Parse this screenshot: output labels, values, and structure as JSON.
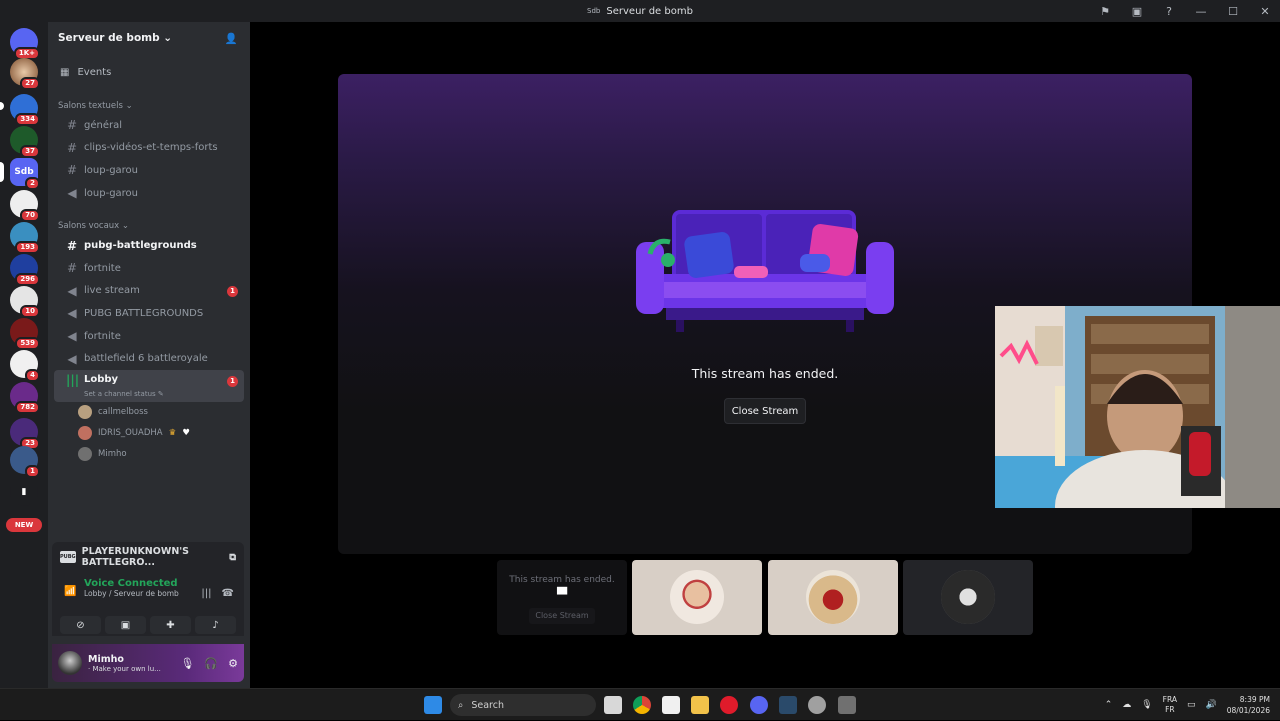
{
  "window": {
    "title": "Serveur de bomb",
    "mini_label": "Sdb"
  },
  "guilds": [
    {
      "badge": "1K+"
    },
    {
      "badge": "27"
    },
    {
      "badge": "334"
    },
    {
      "badge": "37"
    },
    {
      "badge": "2",
      "label": "Sdb"
    },
    {
      "badge": "70"
    },
    {
      "badge": "193"
    },
    {
      "badge": "296"
    },
    {
      "badge": "10"
    },
    {
      "badge": "539"
    },
    {
      "badge": "4"
    },
    {
      "badge": "782"
    },
    {
      "badge": "23"
    },
    {
      "badge": "1"
    },
    {
      "badge": ""
    }
  ],
  "new_label": "NEW",
  "server": {
    "name": "Serveur de bomb"
  },
  "events_label": "Events",
  "text_category": "Salons textuels",
  "text_channels": [
    {
      "name": "général"
    },
    {
      "name": "clips-vidéos-et-temps-forts"
    },
    {
      "name": "loup-garou"
    },
    {
      "name": "loup-garou"
    }
  ],
  "voice_category": "Salons vocaux",
  "voice_channels": [
    {
      "name": "pubg-battlegrounds",
      "bright": true
    },
    {
      "name": "fortnite"
    },
    {
      "name": "live stream",
      "badge": "1"
    },
    {
      "name": "PUBG BATTLEGROUNDS"
    },
    {
      "name": "fortnite"
    },
    {
      "name": "battlefield 6 battleroyale"
    }
  ],
  "lobby": {
    "name": "Lobby",
    "badge": "1",
    "status": "Set a channel status",
    "users": [
      {
        "name": "callmelboss"
      },
      {
        "name": "IDRIS_OUADHA"
      },
      {
        "name": "Mimho"
      }
    ]
  },
  "activity": {
    "game": "PLAYERUNKNOWN'S BATTLEGRO...",
    "icon_text": "PUBG"
  },
  "voice": {
    "title": "Voice Connected",
    "subtitle": "Lobby / Serveur de bomb"
  },
  "user": {
    "name": "Mimho",
    "status": "· Make your own lu..."
  },
  "stream": {
    "ended_text": "This stream has ended.",
    "close_label": "Close Stream"
  },
  "tiles": {
    "ended_text": "This stream has ended.",
    "close_label": "Close Stream"
  },
  "taskbar": {
    "search": "Search",
    "lang_top": "FRA",
    "lang_bottom": "FR",
    "time": "8:39 PM",
    "date": "08/01/2026"
  },
  "colors": {
    "accent": "#5865f2",
    "online": "#23a55a",
    "badge": "#da373c"
  }
}
